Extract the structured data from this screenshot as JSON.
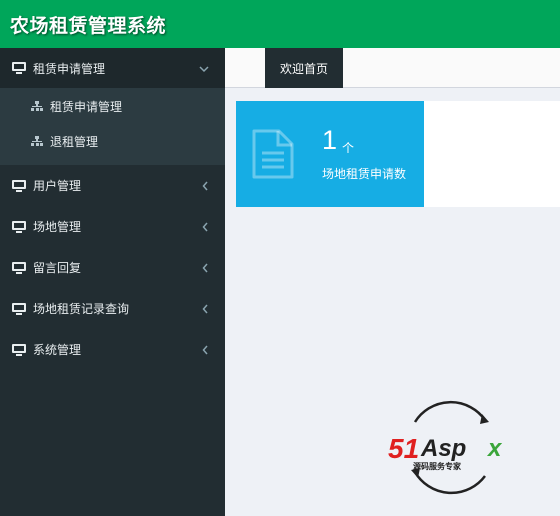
{
  "app": {
    "title": "农场租赁管理系统"
  },
  "sidebar": {
    "items": [
      {
        "label": "租赁申请管理",
        "icon": "desktop-icon",
        "expanded": true,
        "children": [
          {
            "label": "租赁申请管理",
            "icon": "sitemap-icon"
          },
          {
            "label": "退租管理",
            "icon": "sitemap-icon"
          }
        ]
      },
      {
        "label": "用户管理",
        "icon": "desktop-icon"
      },
      {
        "label": "场地管理",
        "icon": "desktop-icon"
      },
      {
        "label": "留言回复",
        "icon": "desktop-icon"
      },
      {
        "label": "场地租赁记录查询",
        "icon": "desktop-icon"
      },
      {
        "label": "系统管理",
        "icon": "desktop-icon"
      }
    ]
  },
  "tabs": [
    {
      "label": "欢迎首页",
      "active": true
    }
  ],
  "stats": [
    {
      "value": "1",
      "unit": "个",
      "label": "场地租赁申请数",
      "icon": "document-icon",
      "color": "#16ade4"
    }
  ],
  "watermark": {
    "brand": "51Aspx",
    "tagline": "源码服务专家"
  },
  "colors": {
    "header": "#00a65a",
    "sidebar": "#222d32",
    "submenu": "#2c3b41",
    "accent": "#16ade4"
  }
}
